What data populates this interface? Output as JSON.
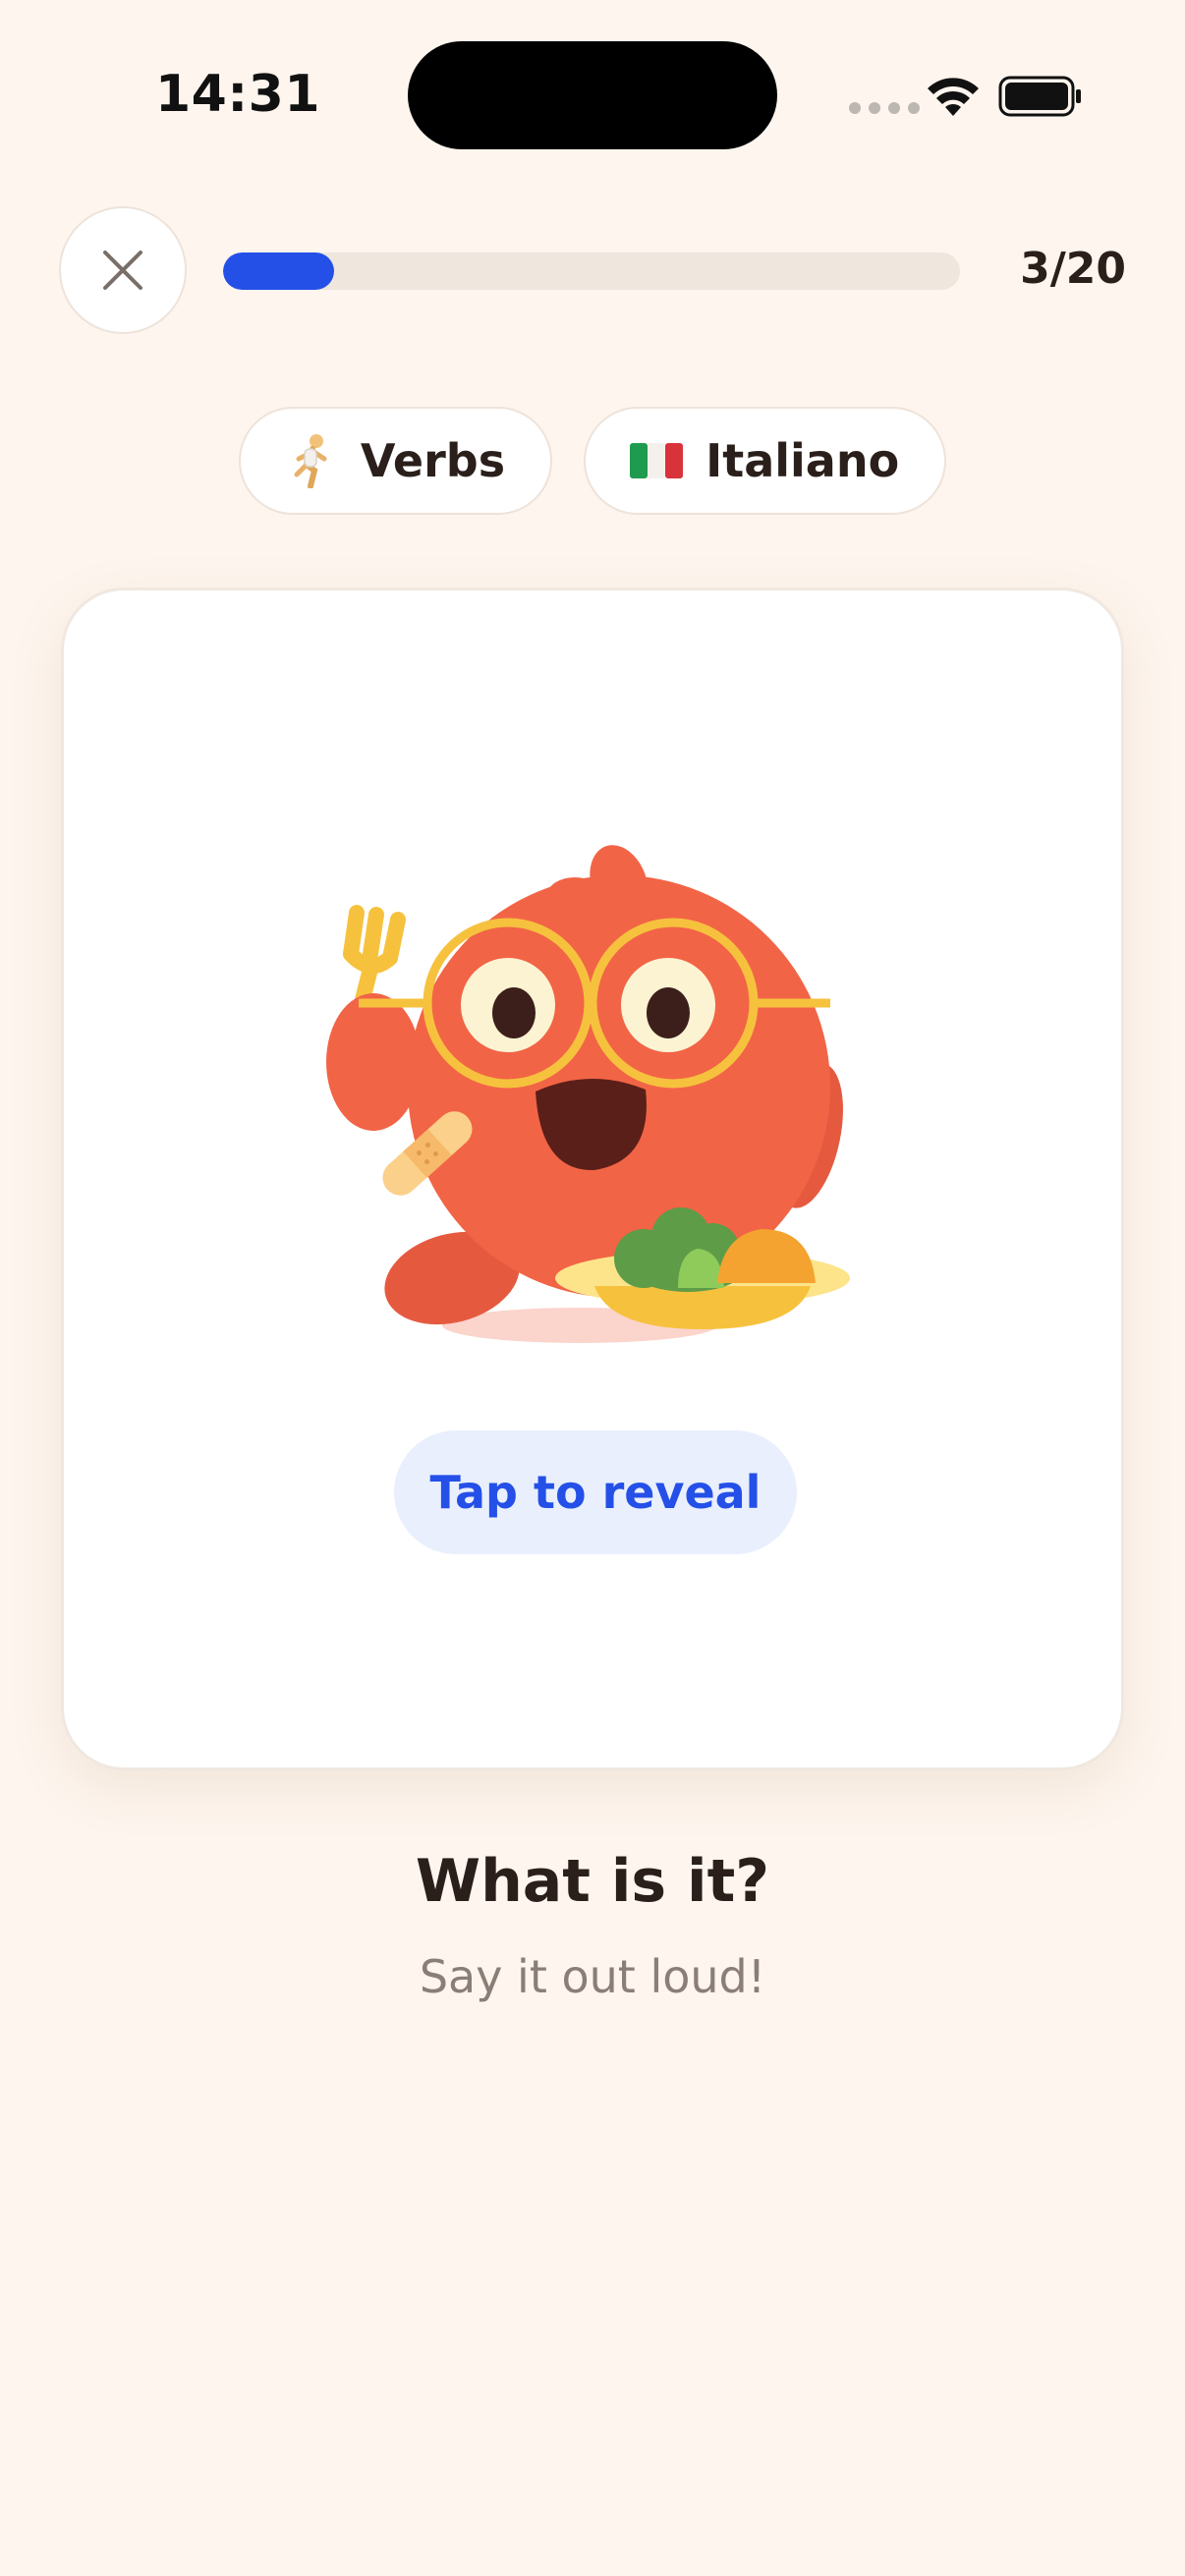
{
  "status_bar": {
    "time": "14:31"
  },
  "top_bar": {
    "close_icon": "close-icon",
    "progress": {
      "current": 3,
      "total": 20,
      "fraction": 0.15,
      "label": "3/20"
    }
  },
  "chips": [
    {
      "icon": "running-person-icon",
      "label": "Verbs"
    },
    {
      "icon": "italy-flag-icon",
      "label": "Italiano"
    }
  ],
  "card": {
    "illustration": "orange-mascot-eating-icon",
    "reveal_label": "Tap to reveal"
  },
  "prompt": {
    "question": "What is it?",
    "hint": "Say it out loud!"
  },
  "colors": {
    "background": "#FDF5EE",
    "accent": "#2450E8",
    "accent_soft": "#E9EFFD",
    "mascot": "#F26446"
  }
}
